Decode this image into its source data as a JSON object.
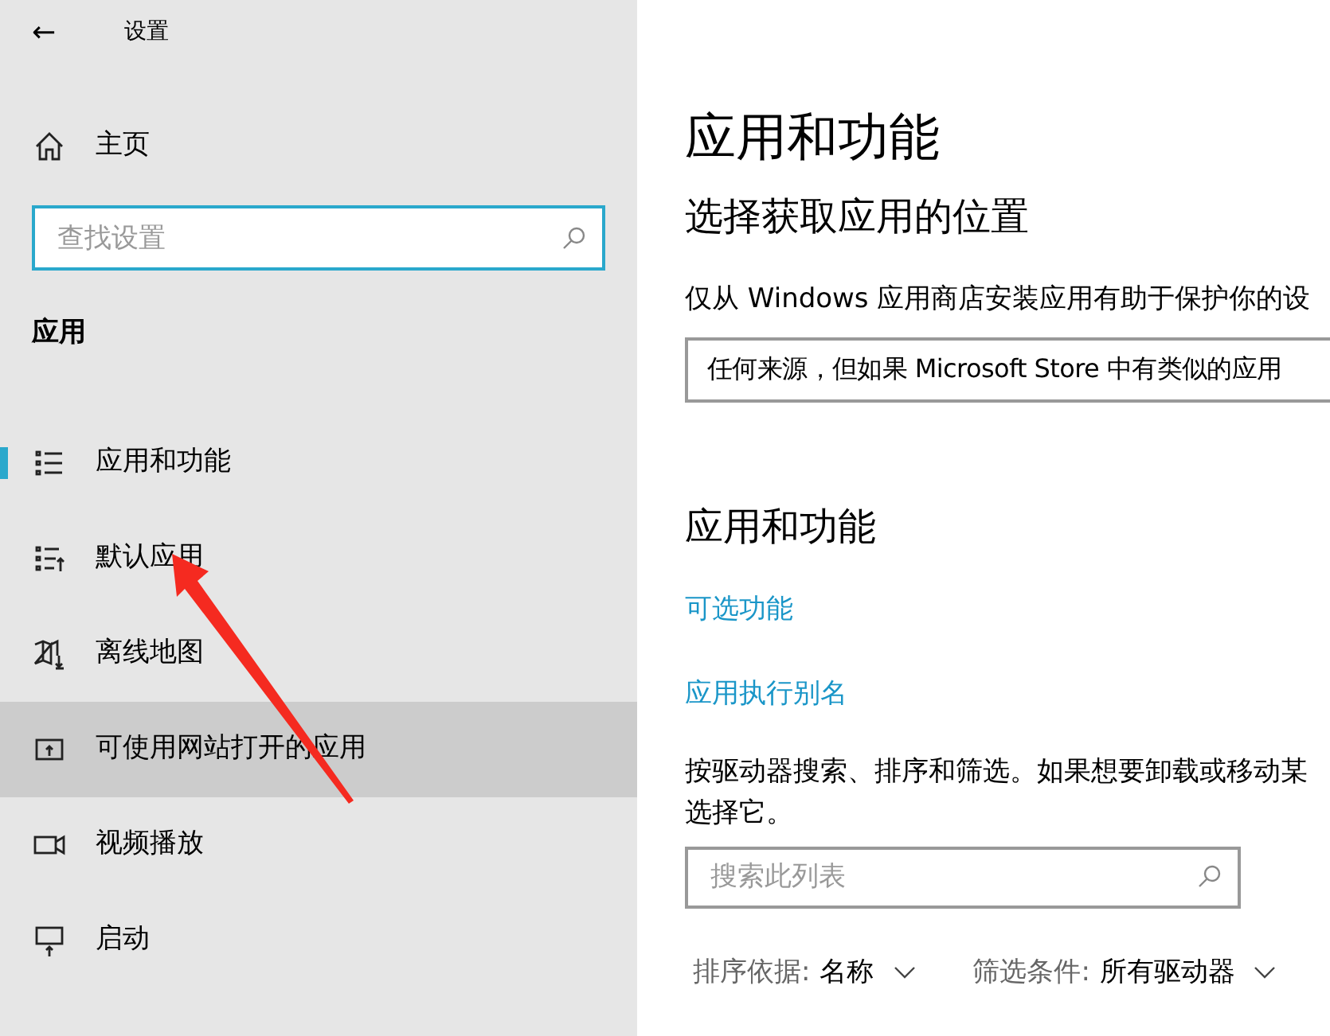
{
  "window": {
    "title": "设置",
    "back": "←"
  },
  "sidebar": {
    "home": "主页",
    "search": {
      "placeholder": "查找设置"
    },
    "section": "应用",
    "items": [
      {
        "label": "应用和功能",
        "selected": true,
        "hovered": false
      },
      {
        "label": "默认应用",
        "selected": false,
        "hovered": false
      },
      {
        "label": "离线地图",
        "selected": false,
        "hovered": false
      },
      {
        "label": "可使用网站打开的应用",
        "selected": false,
        "hovered": true
      },
      {
        "label": "视频播放",
        "selected": false,
        "hovered": false
      },
      {
        "label": "启动",
        "selected": false,
        "hovered": false
      }
    ]
  },
  "main": {
    "title": "应用和功能",
    "install_heading": "选择获取应用的位置",
    "install_text": "仅从 Windows 应用商店安装应用有助于保护你的设",
    "source_dropdown": "任何来源，但如果 Microsoft Store 中有类似的应用",
    "apps_heading": "应用和功能",
    "links": [
      "可选功能",
      "应用执行别名"
    ],
    "description_lines": [
      "按驱动器搜索、排序和筛选。如果想要卸载或移动某",
      "选择它。"
    ],
    "list_search": {
      "placeholder": "搜索此列表"
    },
    "sort": {
      "label": "排序依据:",
      "value": "名称"
    },
    "filter": {
      "label": "筛选条件:",
      "value": "所有驱动器"
    }
  }
}
